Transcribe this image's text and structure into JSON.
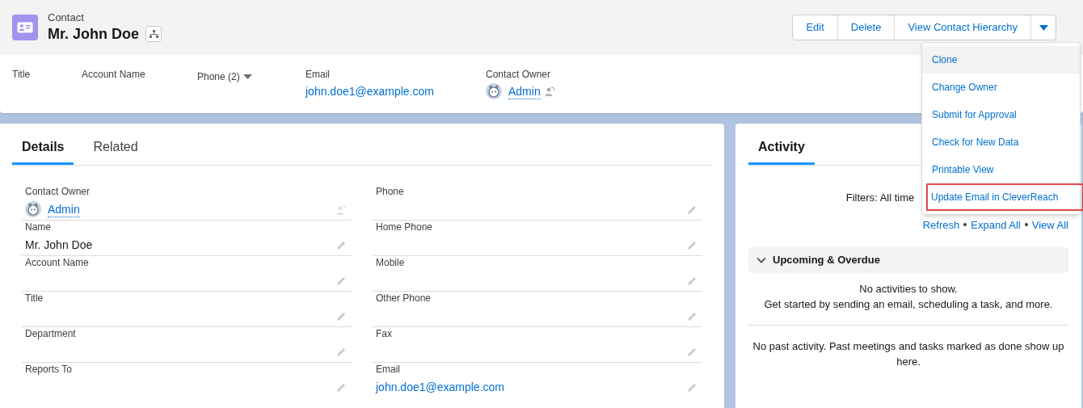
{
  "header": {
    "object_type": "Contact",
    "name": "Mr. John Doe",
    "actions": [
      "Edit",
      "Delete",
      "View Contact Hierarchy"
    ]
  },
  "menu": [
    {
      "label": "Clone",
      "selected": true,
      "outlined": false
    },
    {
      "label": "Change Owner",
      "selected": false,
      "outlined": false
    },
    {
      "label": "Submit for Approval",
      "selected": false,
      "outlined": false
    },
    {
      "label": "Check for New Data",
      "selected": false,
      "outlined": false
    },
    {
      "label": "Printable View",
      "selected": false,
      "outlined": false
    },
    {
      "label": "Update Email in CleverReach",
      "selected": false,
      "outlined": true
    }
  ],
  "highlights": [
    {
      "label": "Title",
      "kind": "text"
    },
    {
      "label": "Account Name",
      "kind": "text"
    },
    {
      "label": "Phone (2)",
      "kind": "dropdown"
    },
    {
      "label": "Email",
      "kind": "link",
      "value": "john.doe1@example.com"
    },
    {
      "label": "Contact Owner",
      "kind": "owner",
      "value": "Admin"
    }
  ],
  "tabs": [
    {
      "label": "Details",
      "selected": true
    },
    {
      "label": "Related",
      "selected": false
    }
  ],
  "fields": [
    {
      "label": "Contact Owner",
      "kind": "owner",
      "value": "Admin"
    },
    {
      "label": "Phone",
      "kind": "text"
    },
    {
      "label": "Name",
      "kind": "text",
      "value": "Mr. John Doe"
    },
    {
      "label": "Home Phone",
      "kind": "text"
    },
    {
      "label": "Account Name",
      "kind": "text"
    },
    {
      "label": "Mobile",
      "kind": "text"
    },
    {
      "label": "Title",
      "kind": "text"
    },
    {
      "label": "Other Phone",
      "kind": "text"
    },
    {
      "label": "Department",
      "kind": "text"
    },
    {
      "label": "Fax",
      "kind": "text"
    },
    {
      "label": "Reports To",
      "kind": "text"
    },
    {
      "label": "Email",
      "kind": "link",
      "value": "john.doe1@example.com"
    }
  ],
  "activity": {
    "tab": {
      "label": "Activity",
      "selected": true
    },
    "filters": "Filters: All time",
    "links": [
      "Refresh",
      "Expand All",
      "View All"
    ],
    "section": {
      "title": "Upcoming & Overdue",
      "expanded": true
    },
    "empty_lines": [
      "No activities to show.",
      "Get started by sending an email, scheduling a task, and more."
    ],
    "past": "No past activity. Past meetings and tasks marked as done show up here."
  }
}
